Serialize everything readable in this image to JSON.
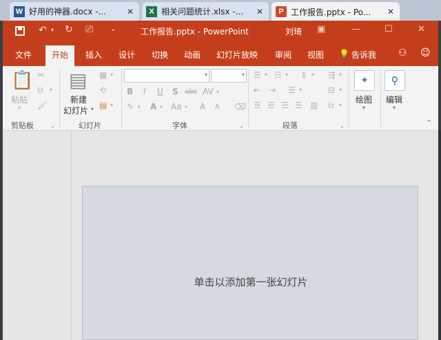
{
  "browser_tabs": [
    {
      "icon": "W",
      "label": "好用的神器.docx -..."
    },
    {
      "icon": "X",
      "label": "相关问题统计.xlsx -..."
    },
    {
      "icon": "P",
      "label": "工作报告.pptx - Po..."
    }
  ],
  "tab_close": "✕",
  "titlebar": {
    "doc_title": "工作报告.pptx  -  PowerPoint",
    "user": "刘琦"
  },
  "ribbon_tabs": [
    "文件",
    "开始",
    "插入",
    "设计",
    "切换",
    "动画",
    "幻灯片放映",
    "审阅",
    "视图"
  ],
  "tell_me": "告诉我",
  "groups": {
    "clipboard": {
      "label": "剪贴板",
      "paste": "粘贴"
    },
    "slides": {
      "label": "幻灯片",
      "new_slide_line1": "新建",
      "new_slide_line2": "幻灯片"
    },
    "font": {
      "label": "字体",
      "bold": "B",
      "italic": "I",
      "underline": "U",
      "shadow": "S",
      "strike": "abc",
      "grow": "A",
      "shrink": "A",
      "case": "Aa",
      "font_color": "A"
    },
    "paragraph": {
      "label": "段落"
    },
    "drawing": {
      "label": "绘图"
    },
    "editing": {
      "label": "编辑"
    }
  },
  "slide": {
    "placeholder": "单击以添加第一张幻灯片"
  },
  "colors": {
    "accent": "#c43e1c",
    "ribbon_bg": "#f3f3f3",
    "slide_bg": "#d5d9e0"
  }
}
